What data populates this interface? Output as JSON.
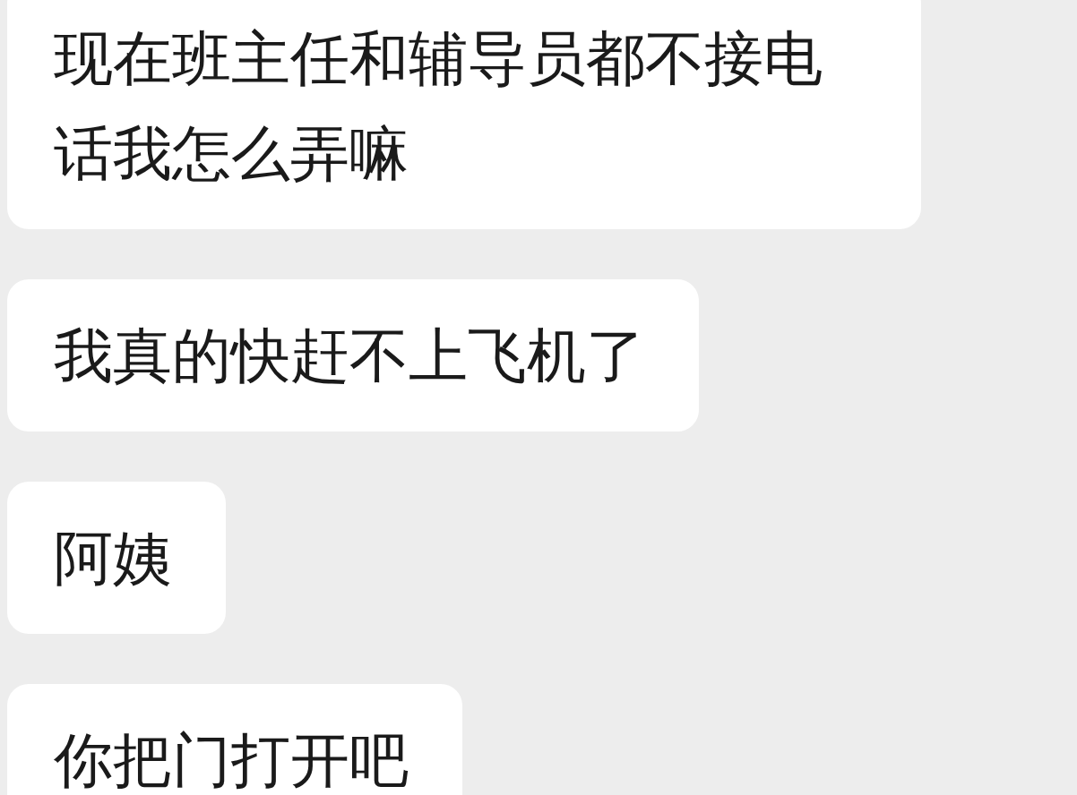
{
  "messages": [
    {
      "text": "现在班主任和辅导员都不接电话我怎么弄嘛"
    },
    {
      "text": "我真的快赶不上飞机了"
    },
    {
      "text": "阿姨"
    },
    {
      "text": "你把门打开吧"
    }
  ]
}
